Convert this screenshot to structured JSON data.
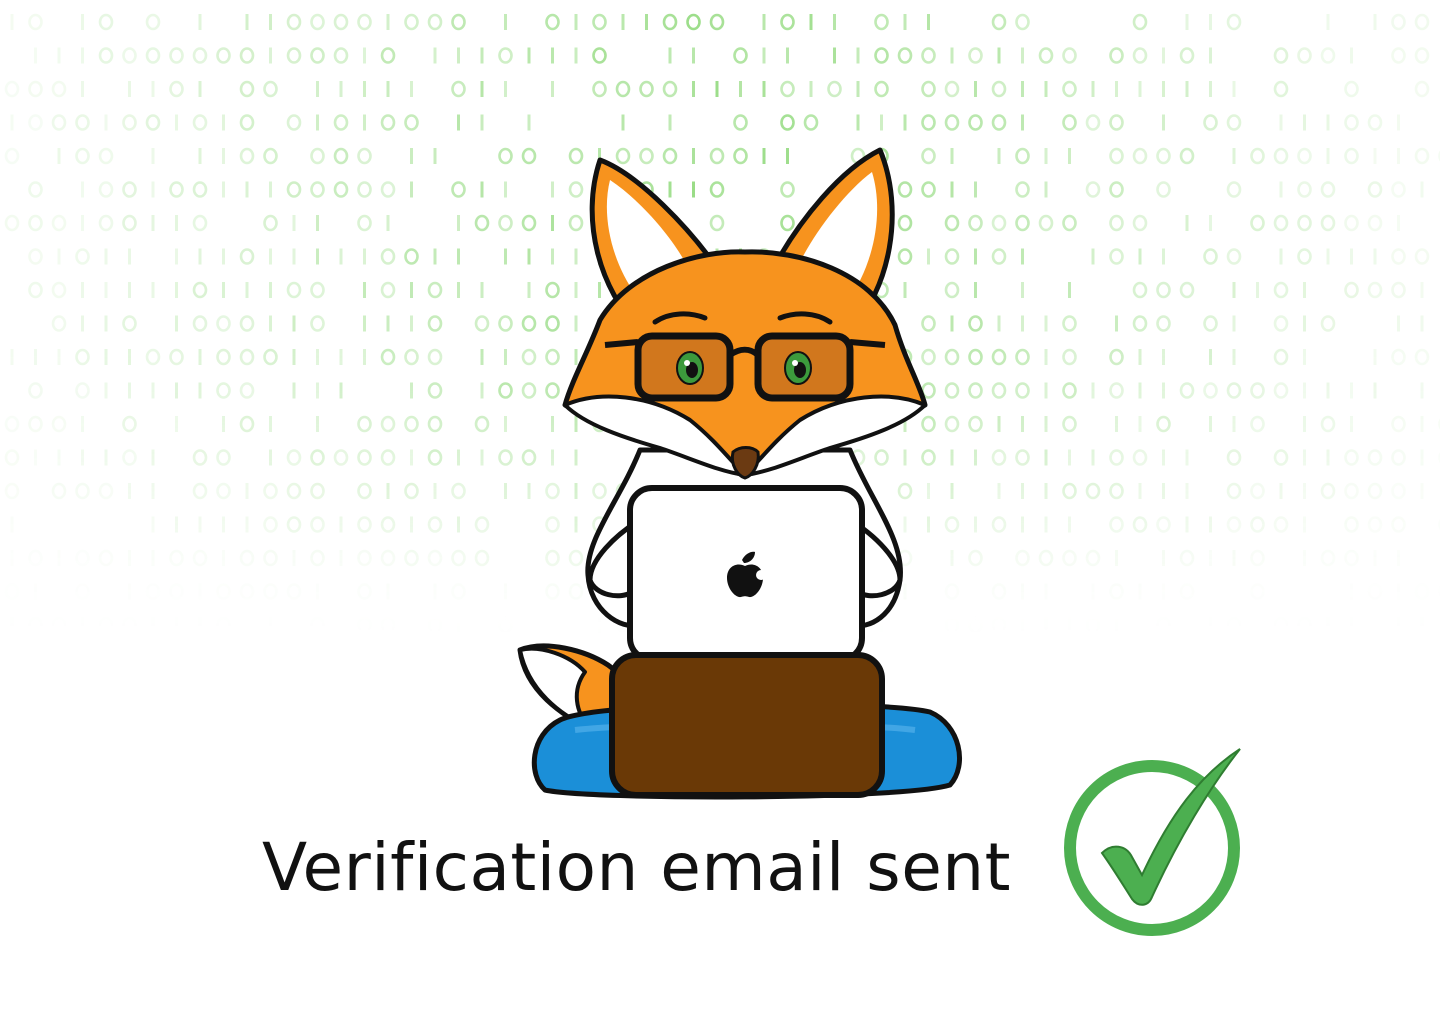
{
  "status": {
    "message": "Verification email sent",
    "success_icon": "check-circle-icon",
    "accent_color": "#4caf50"
  },
  "illustration": {
    "subject": "fox-with-laptop",
    "laptop_logo": "apple-logo-icon",
    "background_pattern": "binary-digits",
    "pattern_color": "#8fd97a",
    "fur_color": "#f7931e",
    "cushion_color": "#1b8fd8",
    "box_color": "#6a3906"
  }
}
